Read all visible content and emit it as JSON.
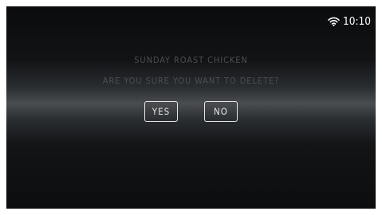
{
  "status_bar": {
    "wifi_icon": "wifi-icon",
    "time": "10:10"
  },
  "dialog": {
    "title": "SUNDAY ROAST CHICKEN",
    "question": "ARE YOU SURE YOU WANT TO DELETE?",
    "yes_label": "YES",
    "no_label": "NO"
  },
  "colors": {
    "background_dark": "#0c0d0f",
    "band_highlight": "#4a4d50",
    "dim_text": "#4c4f52",
    "button_text": "#e6e6e6"
  }
}
